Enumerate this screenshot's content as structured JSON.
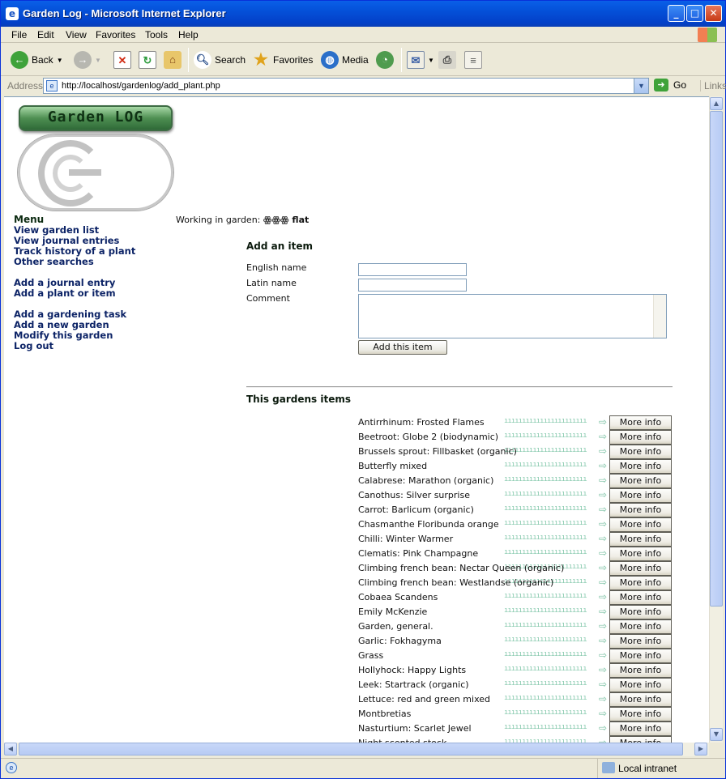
{
  "window": {
    "title": "Garden Log - Microsoft Internet Explorer",
    "min_label": "_",
    "max_label": "□",
    "close_label": "✕"
  },
  "menu": [
    "File",
    "Edit",
    "View",
    "Favorites",
    "Tools",
    "Help"
  ],
  "toolbar": {
    "back": "Back",
    "search": "Search",
    "favorites": "Favorites",
    "media": "Media"
  },
  "address": {
    "label": "Address",
    "url": "http://localhost/gardenlog/add_plant.php",
    "go": "Go",
    "links": "Links"
  },
  "status": {
    "zone": "Local intranet"
  },
  "logo": {
    "text": "Garden LOG"
  },
  "sidebar": {
    "title": "Menu",
    "group1": [
      "View garden list",
      "View journal entries",
      "Track history of a plant",
      "Other searches"
    ],
    "group2": [
      "Add a journal entry",
      "Add a plant or item"
    ],
    "group3": [
      "Add a gardening task",
      "Add a new garden",
      "Modify this garden",
      "Log out"
    ]
  },
  "garden": {
    "label": "Working in garden:",
    "name": "ꙮꙮꙮ flat"
  },
  "form": {
    "title": "Add an item",
    "english_label": "English name",
    "latin_label": "Latin name",
    "comment_label": "Comment",
    "english_value": "",
    "latin_value": "",
    "comment_value": "",
    "submit": "Add this item"
  },
  "items": {
    "title": "This gardens items",
    "more_label": "More info",
    "list": [
      "Antirrhinum: Frosted Flames",
      "Beetroot: Globe 2 (biodynamic)",
      "Brussels sprout: Fillbasket (organic)",
      "Butterfly mixed",
      "Calabrese: Marathon (organic)",
      "Canothus: Silver surprise",
      "Carrot: Barlicum (organic)",
      "Chasmanthe Floribunda orange",
      "Chilli: Winter Warmer",
      "Clematis: Pink Champagne",
      "Climbing french bean: Nectar Queen (organic)",
      "Climbing french bean: Westlandse (organic)",
      "Cobaea Scandens",
      "Emily McKenzie",
      "Garden, general.",
      "Garlic: Fokhagyma",
      "Grass",
      "Hollyhock: Happy Lights",
      "Leek: Startrack (organic)",
      "Lettuce: red and green mixed",
      "Montbretias",
      "Nasturtium: Scarlet Jewel",
      "Night scented stock"
    ]
  },
  "colors": {
    "nav_link": "#0c2366",
    "title_bar": "#0450d8",
    "dots": "#86c9ad"
  }
}
